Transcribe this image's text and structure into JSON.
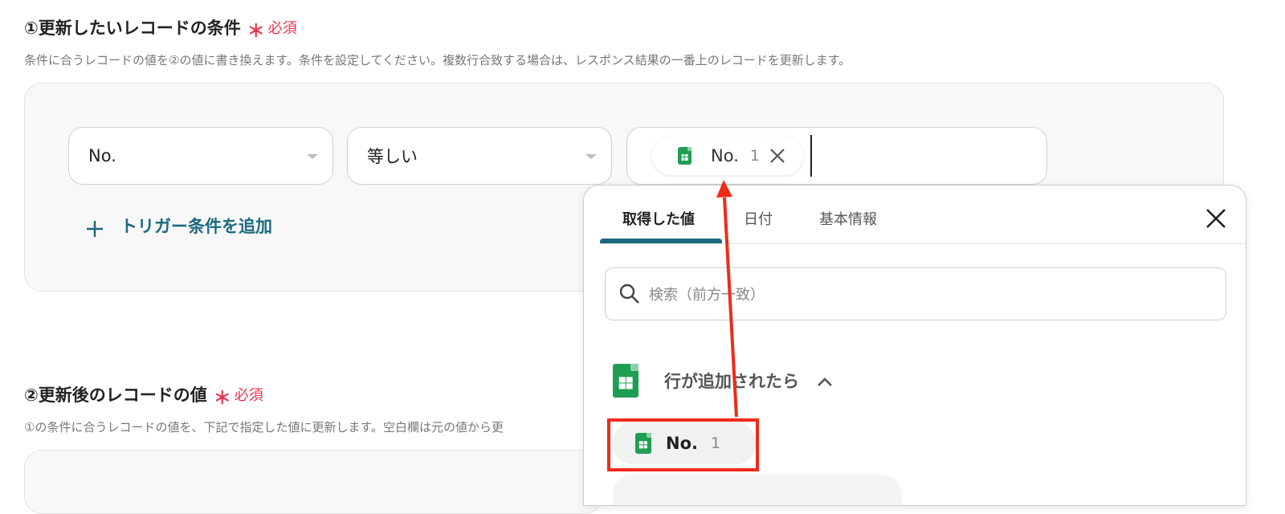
{
  "section1": {
    "title": "①更新したいレコードの条件",
    "required_mark": "＊",
    "required_text": "必須",
    "description": "条件に合うレコードの値を②の値に書き換えます。条件を設定してください。複数行合致する場合は、レスポンス結果の一番上のレコードを更新します。",
    "condition": {
      "field_select": "No.",
      "operator_select": "等しい",
      "value_chip": {
        "label": "No.",
        "value": "1"
      }
    },
    "add_condition_label": "トリガー条件を追加"
  },
  "section2": {
    "title": "②更新後のレコードの値",
    "required_mark": "＊",
    "required_text": "必須",
    "description": "①の条件に合うレコードの値を、下記で指定した値に更新します。空白欄は元の値から更"
  },
  "popup": {
    "tabs": [
      {
        "label": "取得した値",
        "active": true
      },
      {
        "label": "日付",
        "active": false
      },
      {
        "label": "基本情報",
        "active": false
      }
    ],
    "search_placeholder": "検索（前方一致）",
    "group": {
      "title": "行が追加されたら",
      "expanded": true,
      "items": [
        {
          "label": "No.",
          "value": "1",
          "highlighted": true
        }
      ]
    }
  },
  "colors": {
    "required": "#e8344e",
    "accent": "#1c6a80",
    "sheets_green": "#1e9e52",
    "annotation_red": "#f02a1a"
  },
  "icons": [
    "google-sheets-icon",
    "close-icon",
    "search-icon",
    "chevron-up-icon",
    "plus-icon",
    "dropdown-caret-icon"
  ]
}
